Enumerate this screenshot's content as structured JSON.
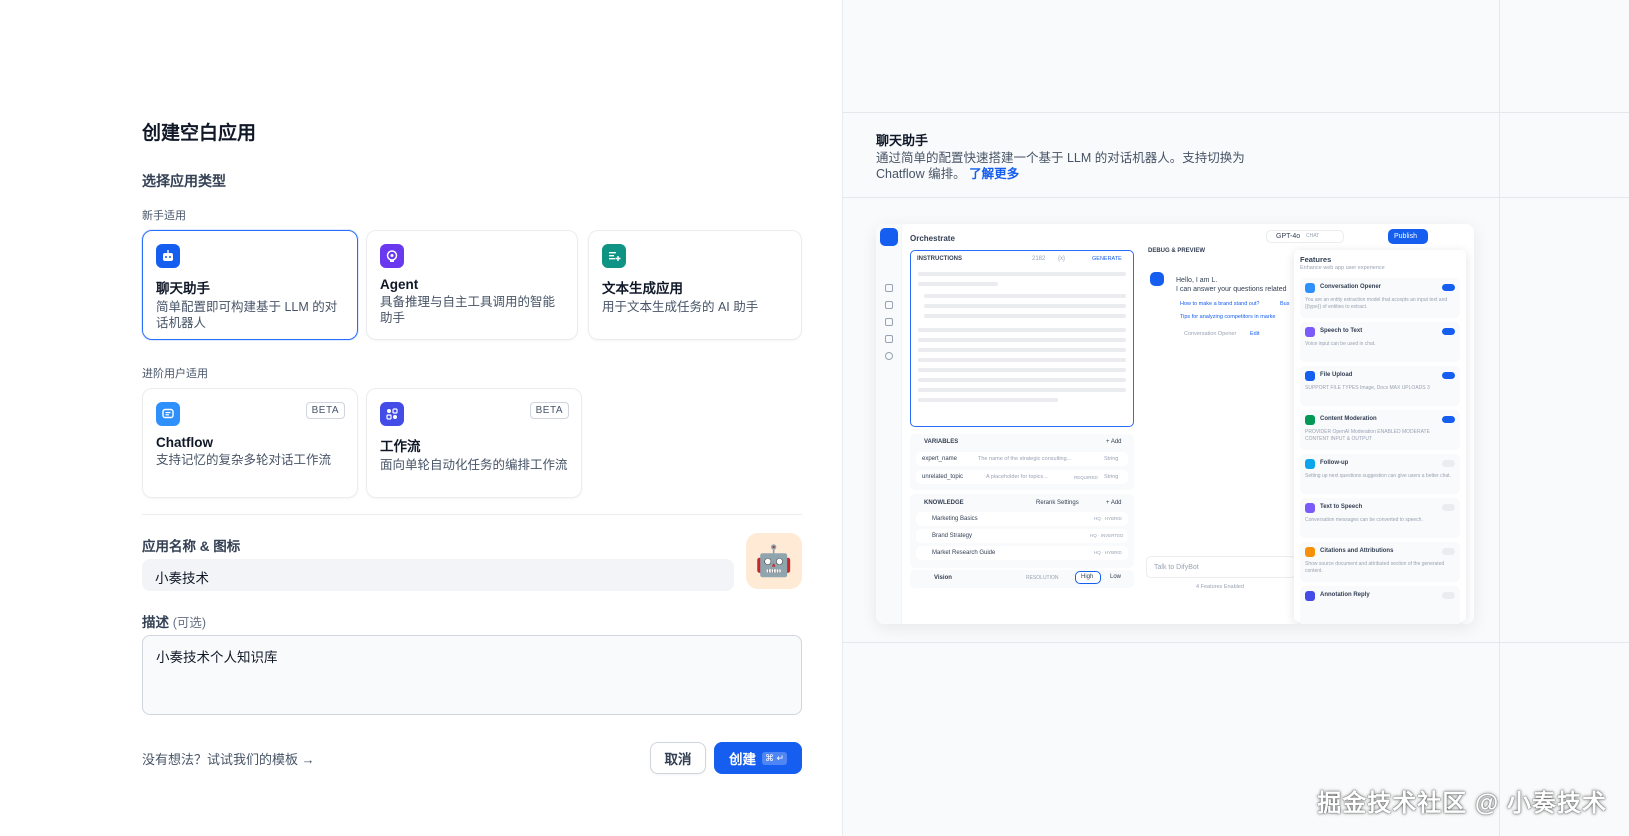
{
  "page_title": "创建空白应用",
  "type_section_label": "选择应用类型",
  "beginner_label": "新手适用",
  "advanced_label": "进阶用户适用",
  "app_types": {
    "chatbot": {
      "name": "聊天助手",
      "desc": "简单配置即可构建基于 LLM 的对话机器人",
      "color": "#155eef",
      "selected": true
    },
    "agent": {
      "name": "Agent",
      "desc": "具备推理与自主工具调用的智能助手",
      "color": "#6938ef"
    },
    "completion": {
      "name": "文本生成应用",
      "desc": "用于文本生成任务的 AI 助手",
      "color": "#0e9384"
    },
    "chatflow": {
      "name": "Chatflow",
      "desc": "支持记忆的复杂多轮对话工作流",
      "badge": "BETA",
      "color": "#2e90fa"
    },
    "workflow": {
      "name": "工作流",
      "desc": "面向单轮自动化任务的编排工作流",
      "badge": "BETA",
      "color": "#444ce7"
    }
  },
  "name_icon_label": "应用名称 & 图标",
  "app_name_value": "小奏技术",
  "avatar_emoji": "🤖",
  "avatar_bg": "#ffead5",
  "desc_label": "描述",
  "desc_optional": "(可选)",
  "desc_value": "小奏技术个人知识库",
  "template_link": "没有想法？试试我们的模板 →",
  "cancel_label": "取消",
  "create_label": "创建",
  "create_shortcut": "⌘ ↵",
  "preview": {
    "title": "聊天助手",
    "desc": "通过简单的配置快速搭建一个基于 LLM 的对话机器人。支持切换为 Chatflow 编排。",
    "learn_more": "了解更多",
    "mock": {
      "orchestrate": "Orchestrate",
      "model": "GPT-4o",
      "chat_tag": "CHAT",
      "publish": "Publish",
      "instructions": "INSTRUCTIONS",
      "char_count": "2182",
      "var_icon": "{x}",
      "generate": "GENERATE",
      "variables": "VARIABLES",
      "add": "+ Add",
      "vars": [
        {
          "name": "expert_name",
          "desc": "The name of the strategic consulting...",
          "type": "String"
        },
        {
          "name": "unrelated_topic",
          "desc": "A placeholder for topics...",
          "req": "REQUIRED",
          "type": "String"
        }
      ],
      "knowledge": "KNOWLEDGE",
      "rerank": "Rerank Settings",
      "kb": [
        {
          "name": "Marketing Basics",
          "tag": "HQ · HYBRID"
        },
        {
          "name": "Brand Strategy",
          "tag": "HQ · INVERTED"
        },
        {
          "name": "Market Research Guide",
          "tag": "HQ · HYBRID"
        }
      ],
      "vision": "Vision",
      "resolution": "RESOLUTION",
      "high": "High",
      "low": "Low",
      "debug": "DEBUG & PREVIEW",
      "greeting1": "Hello, I am L.",
      "greeting2": "I can answer your questions related",
      "sugg1": "How to make a brand stand out?",
      "sugg1b": "Bus",
      "sugg2": "Tips for analyzing competitors in marke",
      "opener_label": "Conversation Opener",
      "edit": "Edit",
      "talk_placeholder": "Talk to DifyBot",
      "features_enabled": "4 Features Enabled",
      "features_title": "Features",
      "features_sub": "Enhance web app user experience",
      "features": [
        {
          "name": "Conversation Opener",
          "desc": "You are an entity extraction model that accepts an input text and {{type}} of entities to extract.",
          "on": true,
          "color": "#2e90fa"
        },
        {
          "name": "Speech to Text",
          "desc": "Voice input can be used in chat.",
          "on": true,
          "color": "#7a5af8"
        },
        {
          "name": "File Upload",
          "desc": "SUPPORT FILE TYPES  Image, Docs   MAX UPLOADS 3",
          "on": true,
          "color": "#155eef"
        },
        {
          "name": "Content Moderation",
          "desc": "PROVIDER OpenAI Moderation   ENABLED MODERATE CONTENT INPUT & OUTPUT",
          "on": true,
          "color": "#039855"
        },
        {
          "name": "Follow-up",
          "desc": "Setting up next questions suggestion can give users a better chat.",
          "on": false,
          "color": "#0ba5ec"
        },
        {
          "name": "Text to Speech",
          "desc": "Conversation messages can be converted to speech.",
          "on": false,
          "color": "#7a5af8"
        },
        {
          "name": "Citations and Attributions",
          "desc": "Show source document and attributed section of the generated content.",
          "on": false,
          "color": "#f79009"
        },
        {
          "name": "Annotation Reply",
          "desc": "",
          "on": false,
          "color": "#444ce7"
        }
      ]
    }
  },
  "watermark": "掘金技术社区 @ 小奏技术"
}
